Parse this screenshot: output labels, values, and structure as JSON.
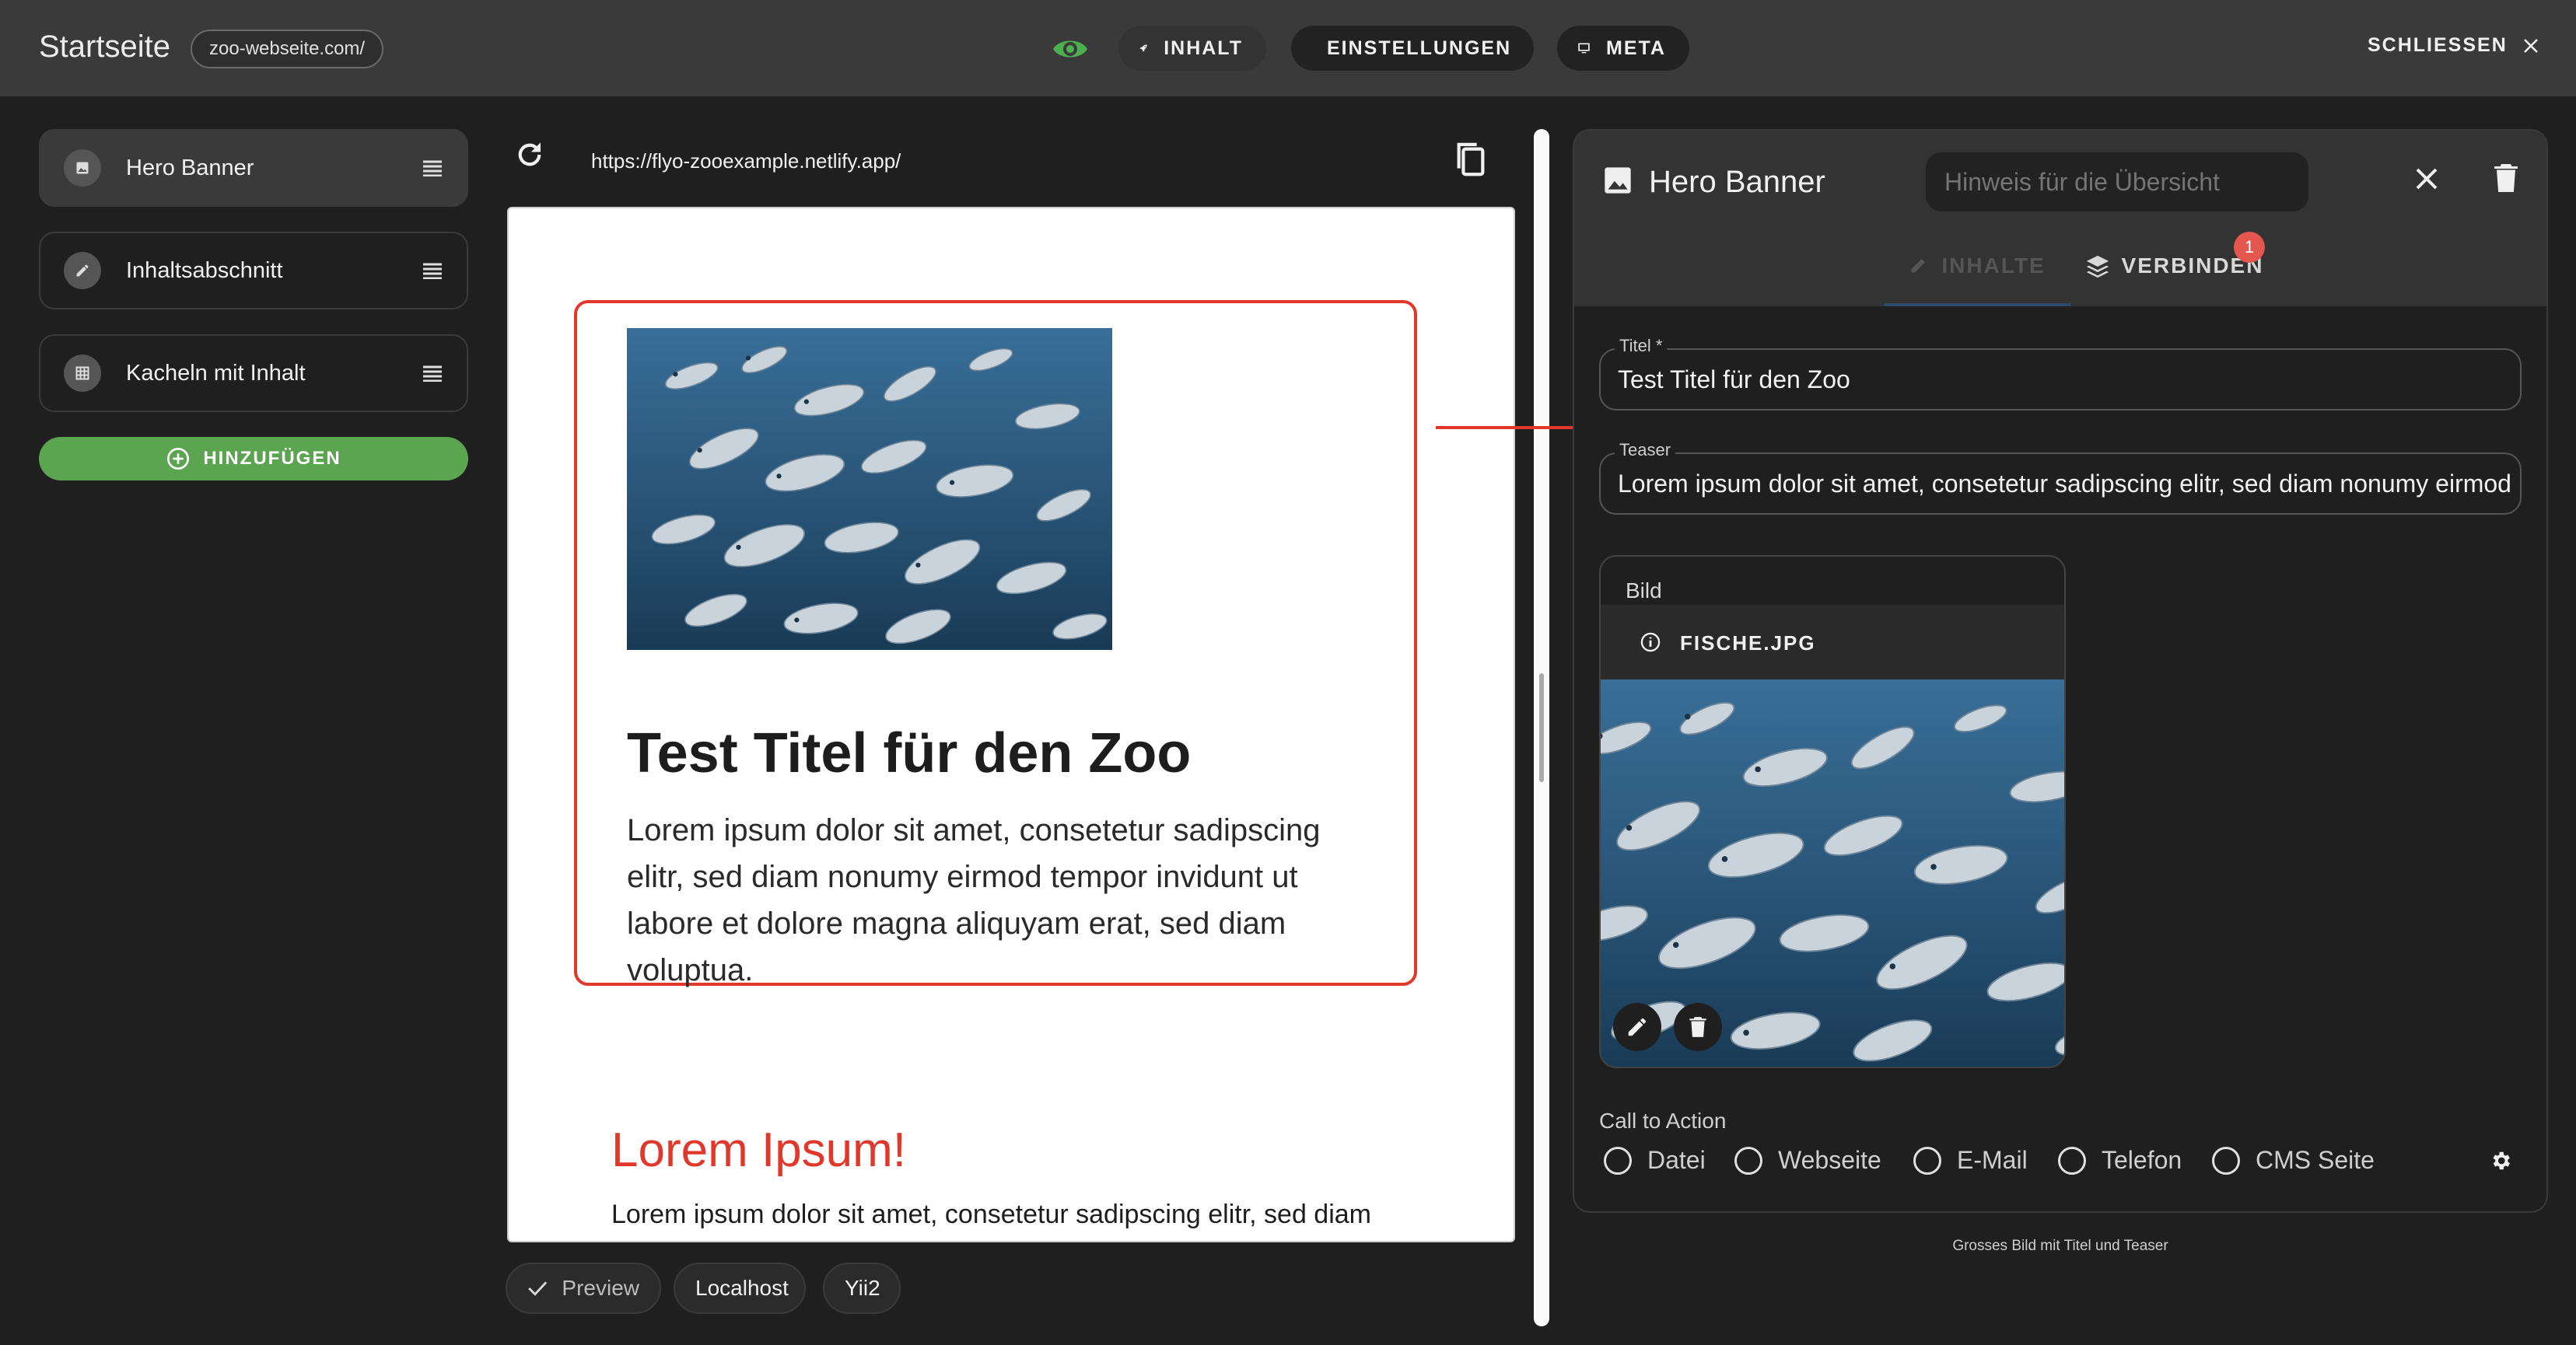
{
  "header": {
    "title": "Startseite",
    "site_chip": "zoo-webseite.com/",
    "tabs": [
      {
        "label": "INHALT",
        "icon": "rocket-icon"
      },
      {
        "label": "EINSTELLUNGEN",
        "icon": "gear-icon"
      },
      {
        "label": "META",
        "icon": "monitor-icon"
      }
    ],
    "close_label": "SCHLIESSEN"
  },
  "sidebar": {
    "items": [
      {
        "label": "Hero Banner",
        "icon": "image-icon",
        "active": true
      },
      {
        "label": "Inhaltsabschnitt",
        "icon": "pencil-icon",
        "active": false
      },
      {
        "label": "Kacheln mit Inhalt",
        "icon": "grid-icon",
        "active": false
      }
    ],
    "add_label": "HINZUFÜGEN"
  },
  "preview": {
    "url": "https://flyo-zooexample.netlify.app/",
    "hero": {
      "title": "Test Titel für den Zoo",
      "teaser": "Lorem ipsum dolor sit amet, consetetur sadipscing elitr, sed diam nonumy eirmod tempor invidunt ut labore et dolore magna aliquyam erat, sed diam voluptua."
    },
    "section": {
      "title": "Lorem Ipsum!",
      "text": "Lorem ipsum dolor sit amet, consetetur sadipscing elitr, sed diam"
    },
    "chips": [
      "Preview",
      "Localhost",
      "Yii2"
    ]
  },
  "panel": {
    "title": "Hero Banner",
    "hint_placeholder": "Hinweis für die Übersicht",
    "tabs": [
      {
        "label": "INHALTE"
      },
      {
        "label": "VERBINDEN",
        "badge": "1"
      }
    ],
    "fields": {
      "titel": {
        "label": "Titel *",
        "value": "Test Titel für den Zoo"
      },
      "teaser": {
        "label": "Teaser",
        "value": "Lorem ipsum dolor sit amet, consetetur sadipscing elitr, sed diam nonumy eirmod tempor invidunt ut labore et dolore magna aliquyam erat, sed diam voluptua."
      }
    },
    "bild": {
      "label": "Bild",
      "filename": "FISCHE.JPG"
    },
    "cta": {
      "label": "Call to Action",
      "options": [
        "Datei",
        "Webseite",
        "E-Mail",
        "Telefon",
        "CMS Seite"
      ]
    },
    "footer_note": "Grosses Bild mit Titel und Teaser"
  },
  "colors": {
    "accent_green": "#5ca550",
    "highlight_red": "#e0382b",
    "badge_red": "#e4574e",
    "eye_green": "#4caf50"
  }
}
